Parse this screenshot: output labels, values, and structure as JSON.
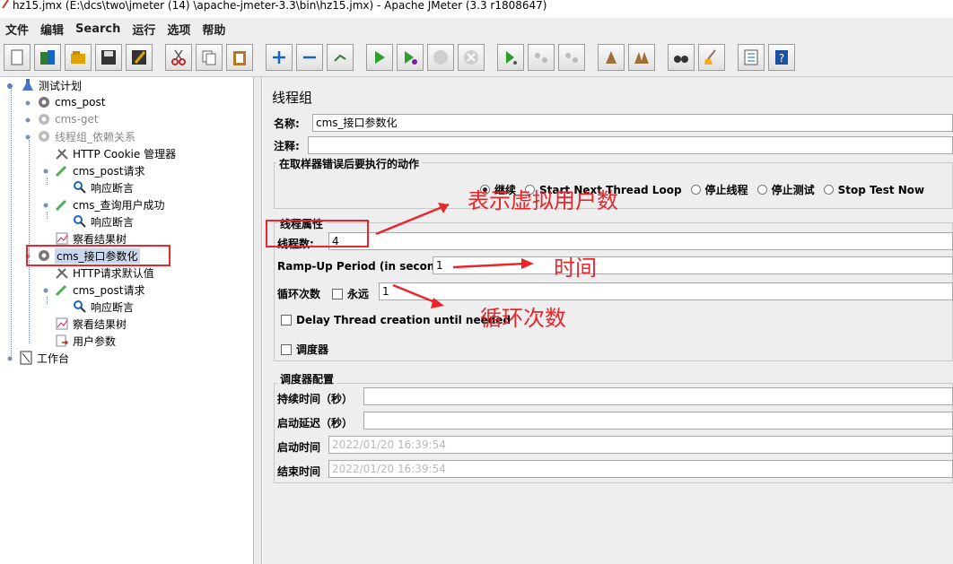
{
  "window": {
    "title": "hz15.jmx (E:\\dcs\\two\\jmeter  (14)  \\apache-jmeter-3.3\\bin\\hz15.jmx) - Apache JMeter (3.3 r1808647)"
  },
  "menu": [
    "文件",
    "编辑",
    "Search",
    "运行",
    "选项",
    "帮助"
  ],
  "toolbar": {
    "buttons": [
      "new-icon",
      "templates-icon",
      "open-icon",
      "save-icon",
      "save-as-icon",
      "cut-icon",
      "copy-icon",
      "paste-icon",
      "expand-icon",
      "collapse-icon",
      "toggle-icon",
      "start-icon",
      "start-no-pause-icon",
      "stop-icon",
      "shutdown-icon",
      "remote-start-icon",
      "remote-stop-icon",
      "remote-exit-icon",
      "clear-icon",
      "clear-all-icon",
      "search-icon",
      "reset-search-icon",
      "function-helper-icon",
      "help-icon"
    ]
  },
  "tree": {
    "items": [
      {
        "label": "测试计划"
      },
      {
        "label": "cms_post"
      },
      {
        "label": "cms-get"
      },
      {
        "label": "线程组_依赖关系"
      },
      {
        "label": "HTTP Cookie 管理器"
      },
      {
        "label": "cms_post请求"
      },
      {
        "label": "响应断言"
      },
      {
        "label": "cms_查询用户成功"
      },
      {
        "label": "响应断言"
      },
      {
        "label": "察看结果树"
      },
      {
        "label": "cms_接口参数化"
      },
      {
        "label": "HTTP请求默认值"
      },
      {
        "label": "cms_post请求"
      },
      {
        "label": "响应断言"
      },
      {
        "label": "察看结果树"
      },
      {
        "label": "用户参数"
      },
      {
        "label": "工作台"
      }
    ]
  },
  "panel": {
    "title": "线程组",
    "name_label": "名称:",
    "name_value": "cms_接口参数化",
    "comment_label": "注释:",
    "comment_value": "",
    "error_group_title": "在取样器错误后要执行的动作",
    "error_options": [
      "继续",
      "Start Next Thread Loop",
      "停止线程",
      "停止测试",
      "Stop Test Now"
    ],
    "error_selected": "继续",
    "thread_group_title": "线程属性",
    "threads_label": "线程数:",
    "threads_value": "4",
    "rampup_label": "Ramp-Up Period (in seconds):",
    "rampup_value": "1",
    "loop_label": "循环次数",
    "forever_label": "永远",
    "loop_value": "1",
    "delay_label": "Delay Thread creation until needed",
    "scheduler_label": "调度器",
    "scheduler_group_title": "调度器配置",
    "duration_label": "持续时间（秒）",
    "duration_value": "",
    "startup_delay_label": "启动延迟（秒）",
    "startup_delay_value": "",
    "start_time_label": "启动时间",
    "start_time_value": "2022/01/20 16:39:54",
    "end_time_label": "结束时间",
    "end_time_value": "2022/01/20 16:39:54"
  },
  "annotations": {
    "virtual_users": "表示虚拟用户数",
    "time": "时间",
    "loop_count": "循环次数",
    "color": "#e8262b"
  }
}
